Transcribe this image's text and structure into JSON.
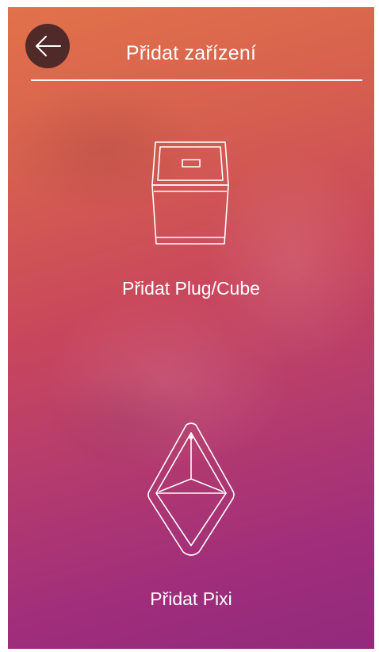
{
  "header": {
    "title": "Přidat zařízení",
    "back_icon": "arrow-left-icon"
  },
  "options": [
    {
      "label": "Přidat Plug/Cube",
      "icon": "plug-cube-device-icon"
    },
    {
      "label": "Přidat Pixi",
      "icon": "pixi-device-icon"
    }
  ],
  "colors": {
    "gradient_top": "#e2724a",
    "gradient_bottom": "#922a7d",
    "foreground": "#ffffff",
    "back_button_bg": "#371e23"
  }
}
